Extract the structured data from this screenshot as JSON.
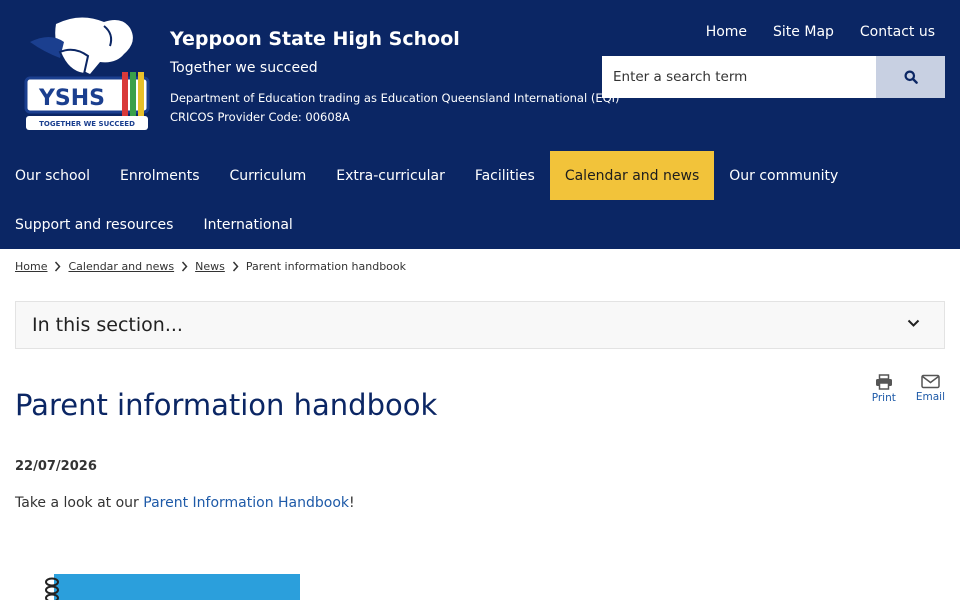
{
  "header": {
    "logo_text": "YSHS",
    "logo_tagline": "TOGETHER WE SUCCEED",
    "title": "Yeppoon State High School",
    "motto": "Together we succeed",
    "department": "Department of Education trading as Education Queensland International (EQI)",
    "cricos": "CRICOS Provider Code: 00608A",
    "util_links": [
      "Home",
      "Site Map",
      "Contact us"
    ],
    "search_placeholder": "Enter a search term"
  },
  "nav": {
    "row1": [
      "Our school",
      "Enrolments",
      "Curriculum",
      "Extra-curricular",
      "Facilities",
      "Calendar and news",
      "Our community"
    ],
    "row2": [
      "Support and resources",
      "International"
    ],
    "active": "Calendar and news"
  },
  "breadcrumb": [
    "Home",
    "Calendar and news",
    "News",
    "Parent information handbook"
  ],
  "section_toggle": "In this section...",
  "page": {
    "title": "Parent information handbook",
    "print_label": "Print",
    "email_label": "Email",
    "date": "22/07/2026",
    "body_prefix": "Take a look at our ",
    "body_link": "Parent Information Handbook",
    "body_suffix": "!"
  },
  "colors": {
    "header_bg": "#0b2664",
    "active_tab": "#f2c33a",
    "link": "#1e5aa8",
    "handbook_cover": "#2b9fdc"
  }
}
